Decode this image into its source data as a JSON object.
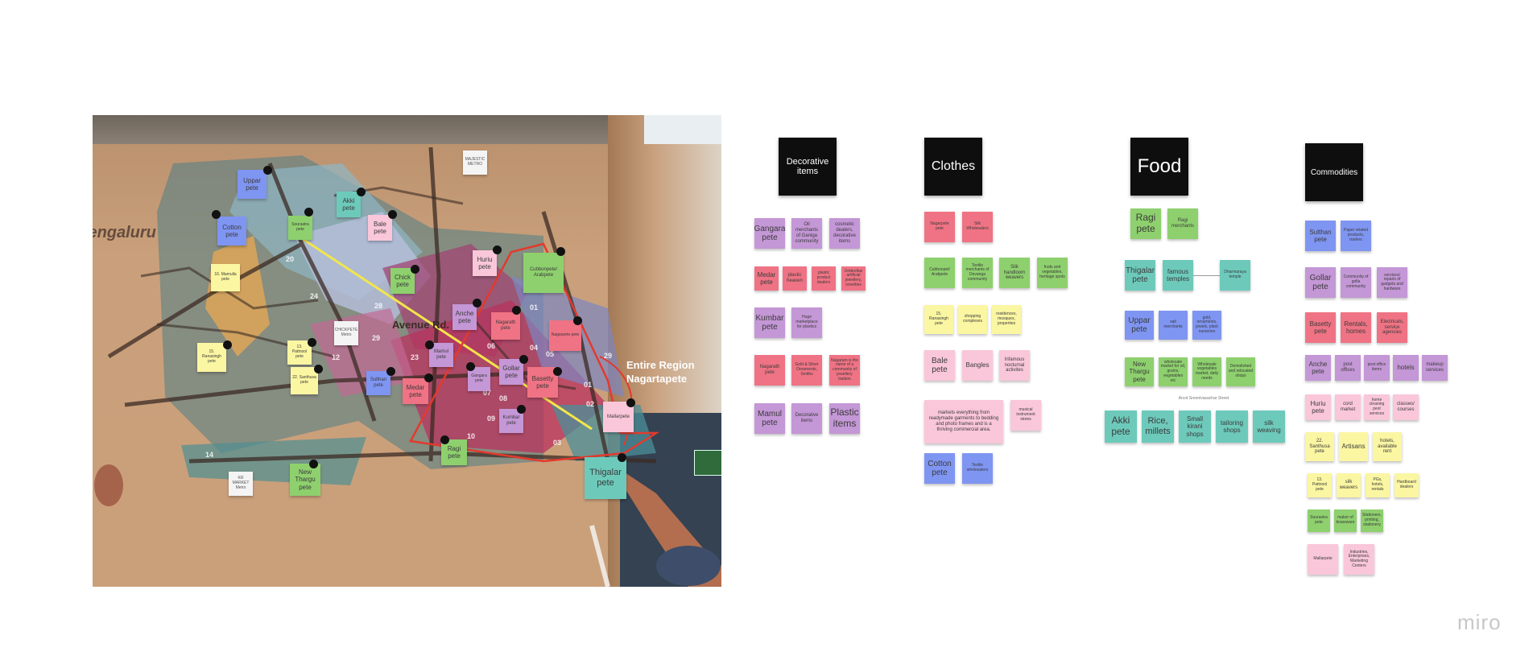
{
  "photo": {
    "title_left": "Bengaluru",
    "avenue": "Avenue Rd.",
    "region_label_1": "Entire Region",
    "region_label_2": "Nagartapete",
    "map_notes": {
      "majestic": "MAJESTIC METRO",
      "uppar": "Uppar pete",
      "cotton": "Cotton pete",
      "sourastra": "Sourastra pete",
      "akki": "Akki pete",
      "bale": "Bale pete",
      "huriu": "Huriu pete",
      "cubbonpet": "Cubbonpete/ Arabpete",
      "mamulla": "16. Mamulla pete",
      "chick": "Chick pete",
      "nagarath": "Nagarath pete",
      "anche": "Anche pete",
      "chickpete_metro": "CHICKPETE Metro",
      "basetty_top": "Nagarpete pete",
      "rarasingh": "15. Ranasingh pete",
      "pattnool": "13. Pattnool pete",
      "santhusa": "22. Santhusa pete",
      "sulthan": "Sulthan pete",
      "mamul": "Mamul pete",
      "gangara": "Gangara pete",
      "gollar": "Gollar pete",
      "basetty": "Basetty pete",
      "medar": "Medar pete",
      "kumbar": "Kumbar pete",
      "mallar": "Mallarpete",
      "ragi": "Ragi pete",
      "thigalar": "Thigalar pete",
      "new_tharagu": "New Thargu pete",
      "kr_market": "KR MARKET Metro"
    }
  },
  "columns": {
    "decorative": {
      "title": "Decorative items",
      "notes": [
        "Gangara pete",
        "Oil merchants of Ganiga community",
        "cosmetic dealers, decorative items",
        "Medar pete",
        "plastic heaven",
        "plastic product dealers",
        "Umbrellas artificial jewellery, novelties",
        "Kumbar pete",
        "Huge marketplace for plastics",
        "Nagarath pete",
        "Gold & Silver Ornaments, Smiths",
        "Nagaram is the name of a community of jewellery traders",
        "Mamul pete",
        "Decorative items",
        "Plastic items"
      ]
    },
    "clothes": {
      "title": "Clothes",
      "notes": [
        "Nagarpete pete",
        "Silk Wholesalers",
        "Cubbonpet/ Arabpete",
        "Textile merchants of Devanga community",
        "Silk handloom weavers",
        "fruits and vegetables, heritage spots",
        "15. Ranasingh pete",
        "shopping complexes",
        "residences, mosques, properties",
        "Bale pete",
        "Bangles",
        "Infamous nocturnal activites",
        "markets everything from readymade garments to bedding and photo frames and is a thriving commercial area.",
        "musical instrument stores",
        "Cotton pete",
        "Textile wholesalers"
      ]
    },
    "food": {
      "title": "Food",
      "notes": [
        "Ragi pete",
        "Ragi merchants",
        "Thigalar pete",
        "famous temples",
        "Dharmaraya temple",
        "Uppar pete",
        "salt merchants",
        "gold, ornaments, jewels, plant nurseries",
        "New Thargu pete",
        "wholesale market for oil, grains, vegetables etc",
        "Wholesale vegetables market, daily needs",
        "Demolished and relocated shops",
        "Akki pete",
        "Rice, millets",
        "Small kirani shops",
        "tailoring shops",
        "silk weaving"
      ],
      "street_label": "Arcot Sreenivasachar Street"
    },
    "commodities": {
      "title": "Commodities",
      "notes": [
        "Sulthan pete",
        "Paper related products, traders",
        "Gollar pete",
        "Community of golla community",
        "services/ repairs of gadgets and hardware",
        "Basetty pete",
        "Rentals, homes",
        "Electricals, service agencies",
        "Anche pete",
        "post offices",
        "post office items",
        "hotels",
        "makeup services",
        "Huriu pete",
        "cord market",
        "home cleaning pest services",
        "classes/ courses",
        "22. Santhusa pete",
        "Artisans",
        "hotels, available rent",
        "13. Pattnool pete",
        "silk weavers",
        "PGs, hotels, rentals",
        "Hardboard dealers",
        "Sourastra pete",
        "maker of brassware",
        "Stationers, printing, stationery",
        "Mallarpete",
        "Industries, Enterprises, Marketing Centers"
      ]
    }
  },
  "branding": {
    "logo": "miro"
  }
}
